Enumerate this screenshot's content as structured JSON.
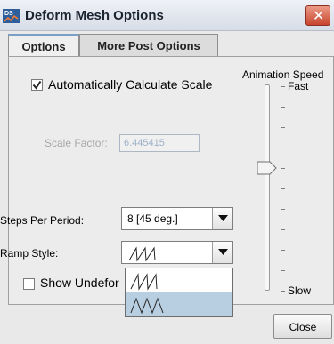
{
  "window": {
    "title": "Deform Mesh Options",
    "app_icon_text": "DS",
    "close_glyph": "✕"
  },
  "tabs": [
    {
      "label": "Options",
      "active": true
    },
    {
      "label": "More Post Options",
      "active": false
    }
  ],
  "options": {
    "auto_scale_label": "Automatically Calculate Scale",
    "auto_scale_checked": true,
    "scale_factor_label": "Scale Factor:",
    "scale_factor_value": "6.445415",
    "steps_label": "Steps Per Period:",
    "steps_value": "8 [45 deg.]",
    "ramp_label": "Ramp Style:",
    "ramp_selected": "sawtooth-ramp-icon",
    "ramp_options": [
      "sawtooth-ramp-icon",
      "triangle-ramp-icon"
    ],
    "ramp_highlighted_index": 1,
    "show_undeformed_label": "Show Undefor",
    "show_undeformed_checked": false
  },
  "animation_speed": {
    "label": "Animation Speed",
    "fast_label": "Fast",
    "slow_label": "Slow",
    "tick_count": 11,
    "level": 0.6
  },
  "footer": {
    "close_label": "Close"
  },
  "colors": {
    "title_close_red": "#c8452f",
    "selection_blue": "#b8cfe1",
    "disabled_text": "#9cb0c8"
  }
}
